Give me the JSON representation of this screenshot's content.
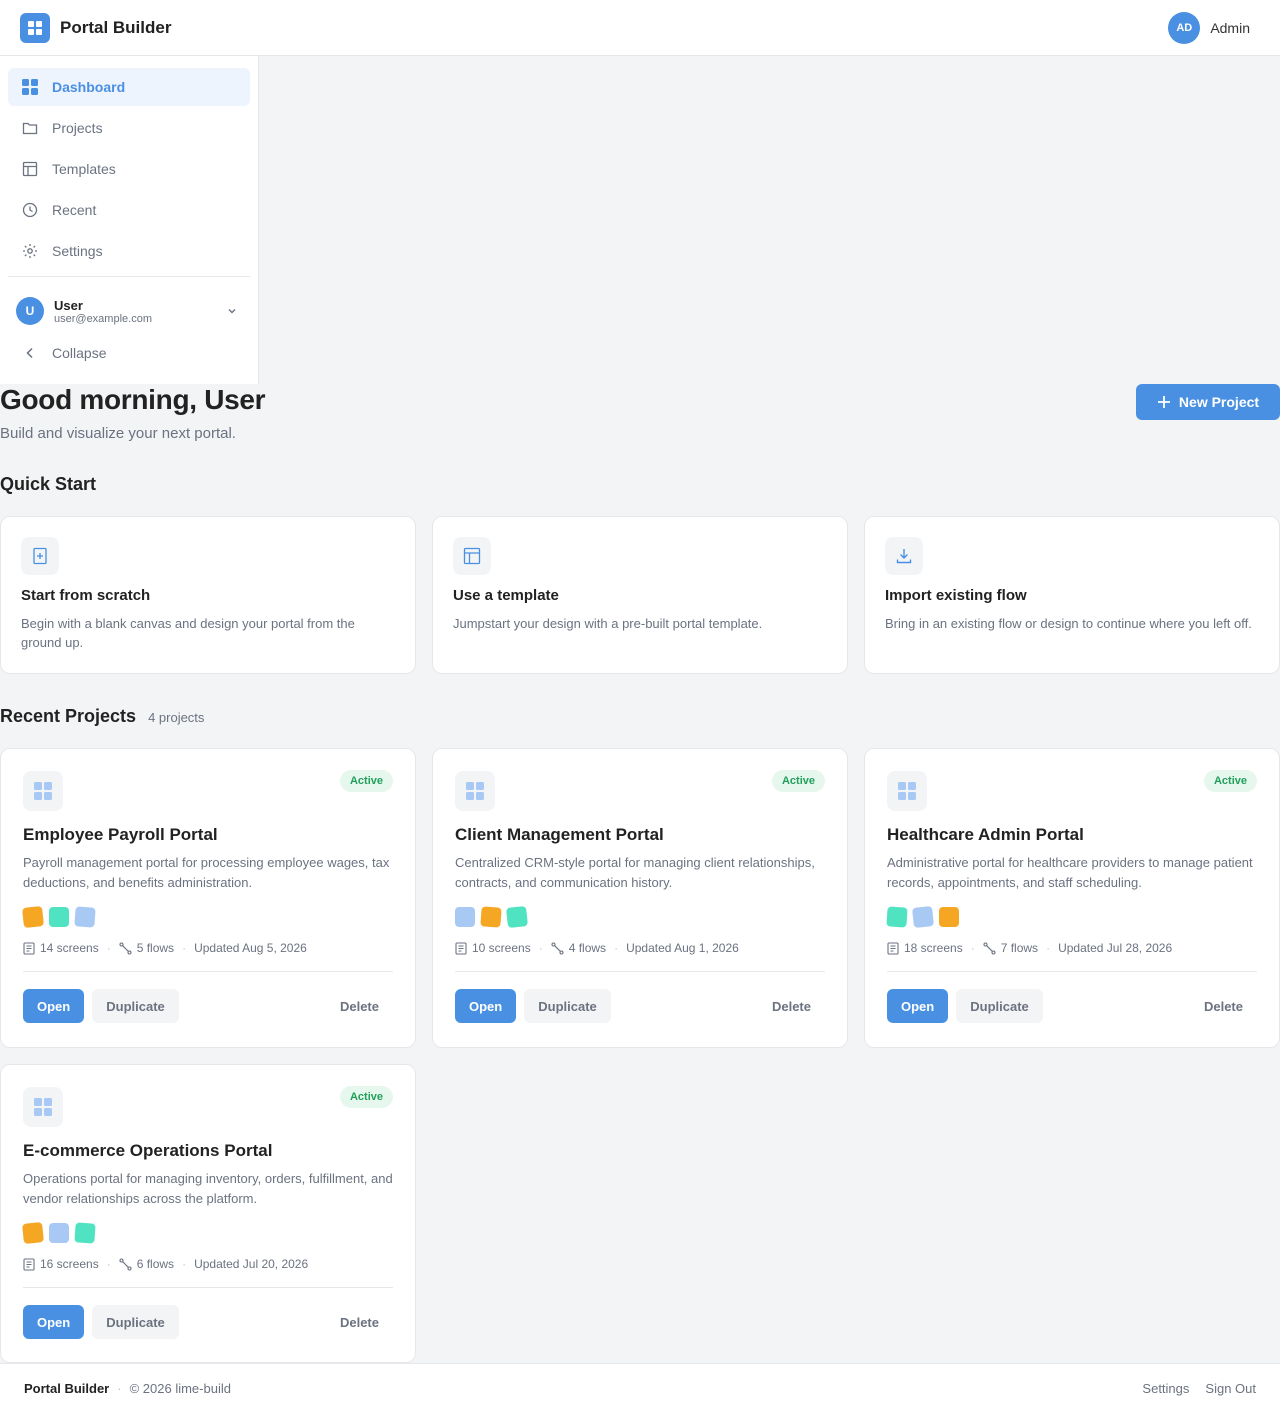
{
  "header": {
    "title": "Portal Builder",
    "avatar_initials": "AD",
    "user_label": "Admin",
    "logo_icon": "grid-icon"
  },
  "sidebar": {
    "items": [
      {
        "label": "Dashboard",
        "icon": "grid-icon",
        "active": true
      },
      {
        "label": "Projects",
        "icon": "folder-icon"
      },
      {
        "label": "Templates",
        "icon": "layout-icon"
      },
      {
        "label": "Recent",
        "icon": "clock-icon"
      },
      {
        "label": "Settings",
        "icon": "gear-icon"
      }
    ],
    "user": {
      "initial": "U",
      "name": "User",
      "email": "user@example.com"
    },
    "collapse_label": "Collapse"
  },
  "main": {
    "greeting": "Good morning, User",
    "subtitle": "Build and visualize your next portal.",
    "new_project_label": "New Project",
    "quick_start_title": "Quick Start",
    "quick_start": [
      {
        "title": "Start from scratch",
        "desc": "Begin with a blank canvas and design your portal from the ground up.",
        "icon": "file-plus-icon"
      },
      {
        "title": "Use a template",
        "desc": "Jumpstart your design with a pre-built portal template.",
        "icon": "layout-icon"
      },
      {
        "title": "Import existing flow",
        "desc": "Bring in an existing flow or design to continue where you left off.",
        "icon": "download-icon"
      }
    ],
    "recent_title": "Recent Projects",
    "recent_count": "4 projects",
    "projects": [
      {
        "title": "Employee Payroll Portal",
        "desc": "Payroll management portal for processing employee wages, tax deductions, and benefits administration.",
        "status": "Active",
        "screens": "14 screens",
        "flows": "5 flows",
        "updated": "Updated Aug 5, 2026",
        "swatches": [
          "#f5a623",
          "#50e3c2",
          "#a9c9f5"
        ],
        "open_label": "Open",
        "duplicate_label": "Duplicate",
        "delete_label": "Delete"
      },
      {
        "title": "Client Management Portal",
        "desc": "Centralized CRM-style portal for managing client relationships, contracts, and communication history.",
        "status": "Active",
        "screens": "10 screens",
        "flows": "4 flows",
        "updated": "Updated Aug 1, 2026",
        "swatches": [
          "#a9c9f5",
          "#f5a623",
          "#50e3c2"
        ],
        "open_label": "Open",
        "duplicate_label": "Duplicate",
        "delete_label": "Delete"
      },
      {
        "title": "Healthcare Admin Portal",
        "desc": "Administrative portal for healthcare providers to manage patient records, appointments, and staff scheduling.",
        "status": "Active",
        "screens": "18 screens",
        "flows": "7 flows",
        "updated": "Updated Jul 28, 2026",
        "swatches": [
          "#50e3c2",
          "#a9c9f5",
          "#f5a623"
        ],
        "open_label": "Open",
        "duplicate_label": "Duplicate",
        "delete_label": "Delete"
      },
      {
        "title": "E-commerce Operations Portal",
        "desc": "Operations portal for managing inventory, orders, fulfillment, and vendor relationships across the platform.",
        "status": "Active",
        "screens": "16 screens",
        "flows": "6 flows",
        "updated": "Updated Jul 20, 2026",
        "swatches": [
          "#f5a623",
          "#a9c9f5",
          "#50e3c2"
        ],
        "open_label": "Open",
        "duplicate_label": "Duplicate",
        "delete_label": "Delete"
      }
    ]
  },
  "footer": {
    "brand": "Portal Builder",
    "separator": "·",
    "copyright": "© 2026 lime-build",
    "links": [
      "Settings",
      "Sign Out"
    ]
  },
  "colors": {
    "accent": "#4a90e2",
    "status_active": "#22a05a",
    "status_active_bg": "#e6f7ee",
    "muted": "#6b7280"
  }
}
